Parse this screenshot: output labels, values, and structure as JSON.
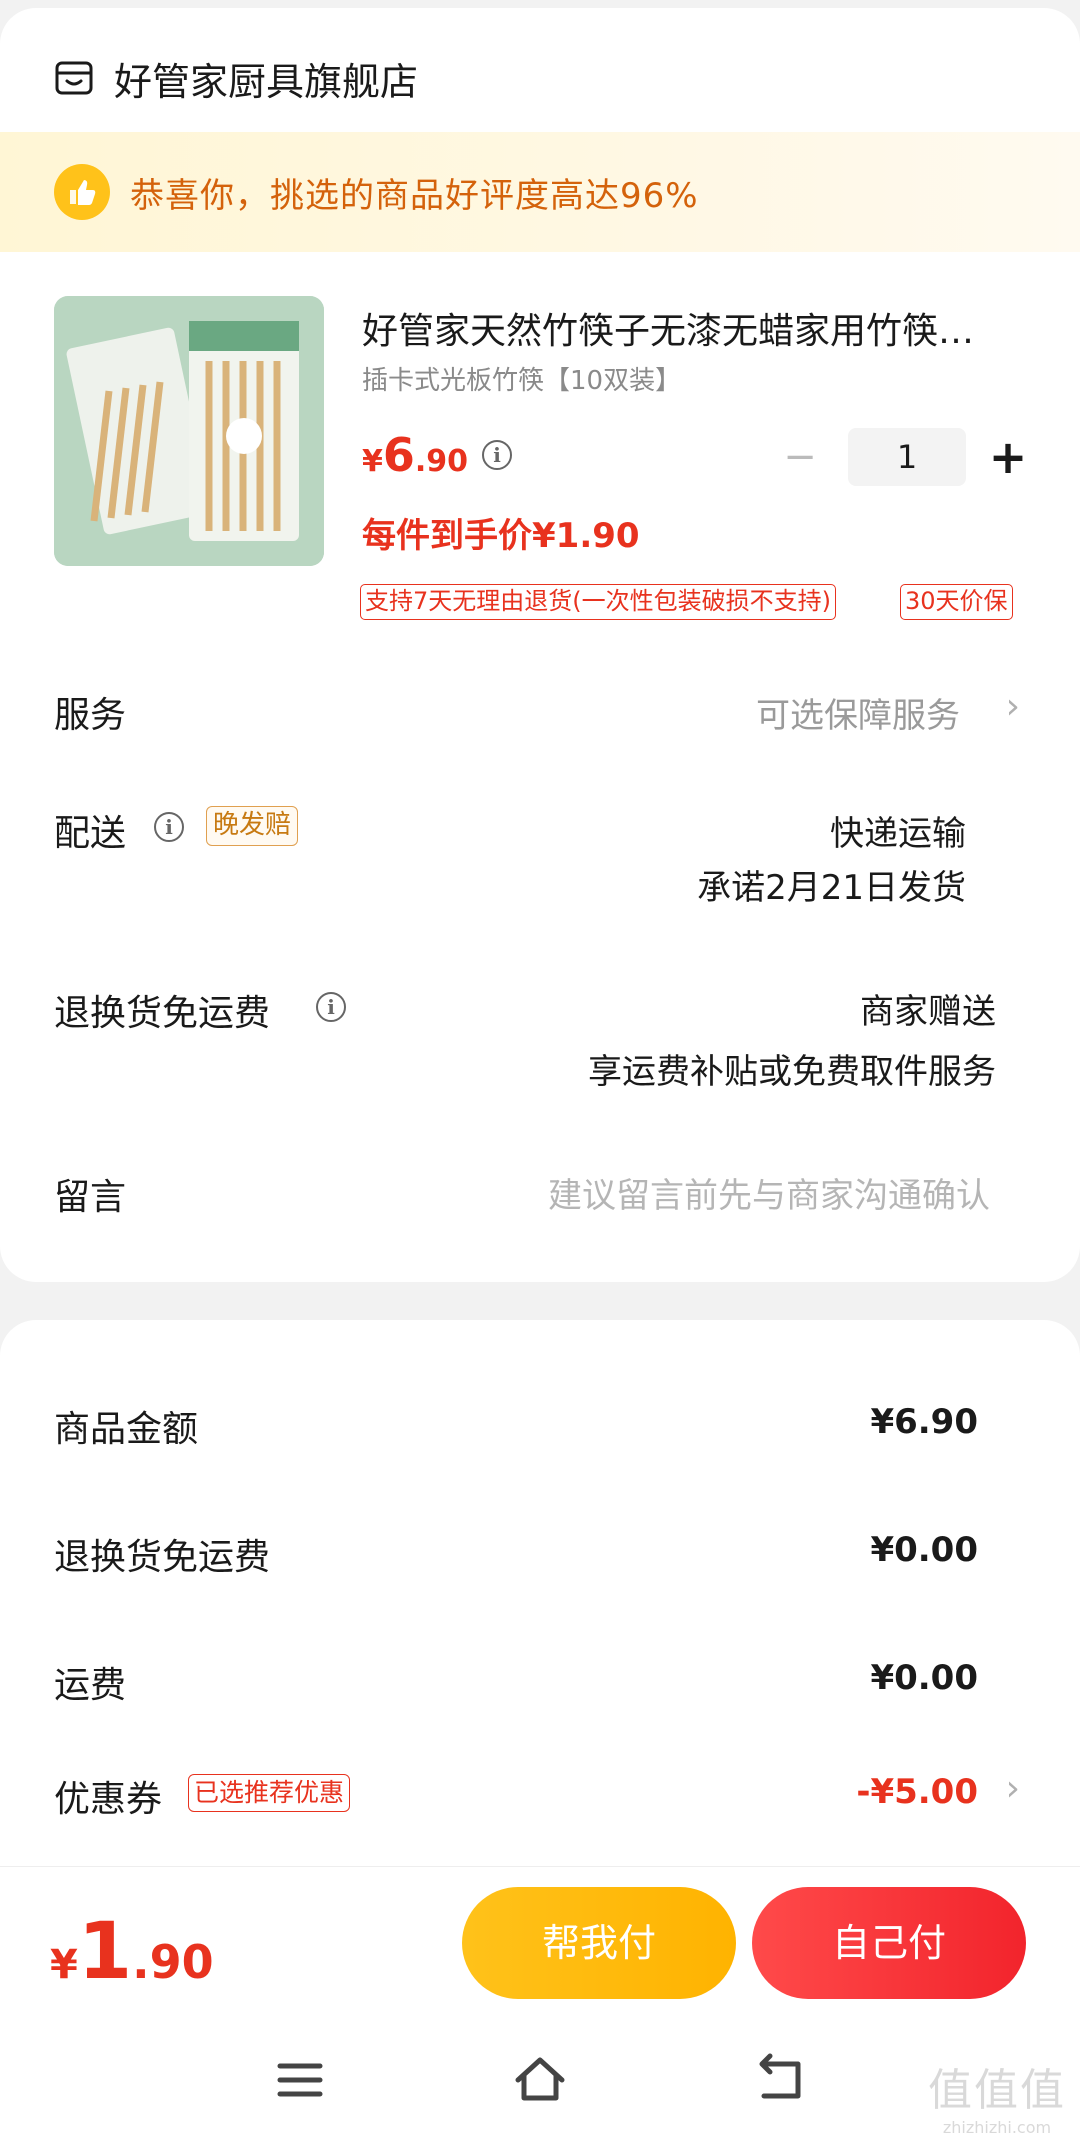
{
  "store": {
    "name": "好管家厨具旗舰店",
    "icon": "store-icon"
  },
  "praise": {
    "icon": "thumbs-up-icon",
    "text": "恭喜你，挑选的商品好评度高达96%"
  },
  "product": {
    "title": "好管家天然竹筷子无漆无蜡家用竹筷…",
    "spec": "插卡式光板竹筷【10双装】",
    "price_yen": "¥",
    "price_int": "6",
    "price_dec": ".90",
    "quantity": "1",
    "unit_price": "每件到手价¥1.90",
    "tags": [
      "支持7天无理由退货(一次性包装破损不支持)",
      "30天价保"
    ]
  },
  "rows": {
    "service": {
      "label": "服务",
      "value": "可选保障服务"
    },
    "delivery": {
      "label": "配送",
      "badge": "晚发赔",
      "line1": "快递运输",
      "line2": "承诺2月21日发货"
    },
    "return_freight": {
      "label": "退换货免运费",
      "line1": "商家赠送",
      "line2": "享运费补贴或免费取件服务"
    },
    "message": {
      "label": "留言",
      "placeholder": "建议留言前先与商家沟通确认"
    }
  },
  "summary": {
    "goods": {
      "label": "商品金额",
      "value": "¥6.90"
    },
    "return_freight": {
      "label": "退换货免运费",
      "value": "¥0.00"
    },
    "shipping": {
      "label": "运费",
      "value": "¥0.00"
    },
    "coupon": {
      "label": "优惠券",
      "badge": "已选推荐优惠",
      "value": "-¥5.00"
    }
  },
  "footer": {
    "total_yen": "¥",
    "total_int": "1",
    "total_dec": ".90",
    "help_pay": "帮我付",
    "self_pay": "自己付"
  },
  "watermark": {
    "main": "值值值",
    "sub": "zhizhizhi.com"
  },
  "colors": {
    "accent_red": "#e8321e",
    "yellow": "#ffc21a",
    "praise_text": "#d4620b"
  }
}
